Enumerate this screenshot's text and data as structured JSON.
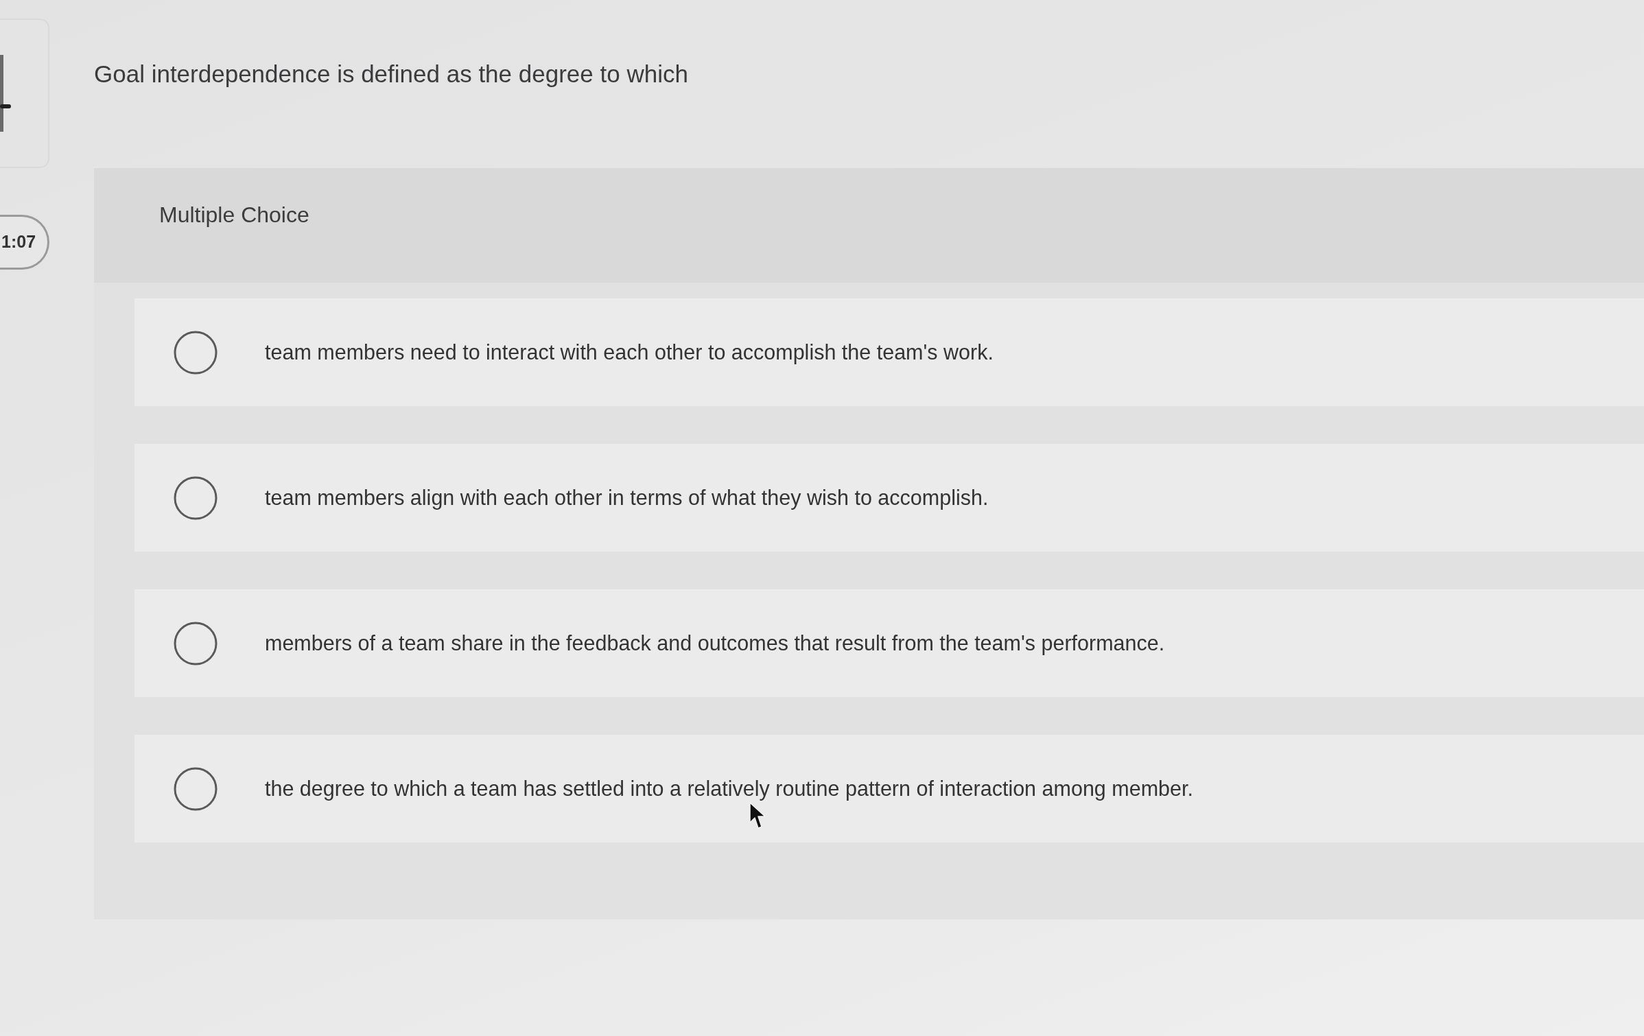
{
  "side_timer": {
    "text": "1:07"
  },
  "question": {
    "text": "Goal interdependence is defined as the degree to which"
  },
  "answer_panel": {
    "type_label": "Multiple Choice",
    "options": [
      {
        "text": "team members need to interact with each other to accomplish the team's work.",
        "selected": false
      },
      {
        "text": "team members align with each other in terms of what they wish to accomplish.",
        "selected": false
      },
      {
        "text": "members of a team share in the feedback and outcomes that result from the team's performance.",
        "selected": false
      },
      {
        "text": "the degree to which a team has settled into a relatively routine pattern of interaction among member.",
        "selected": false
      }
    ]
  }
}
